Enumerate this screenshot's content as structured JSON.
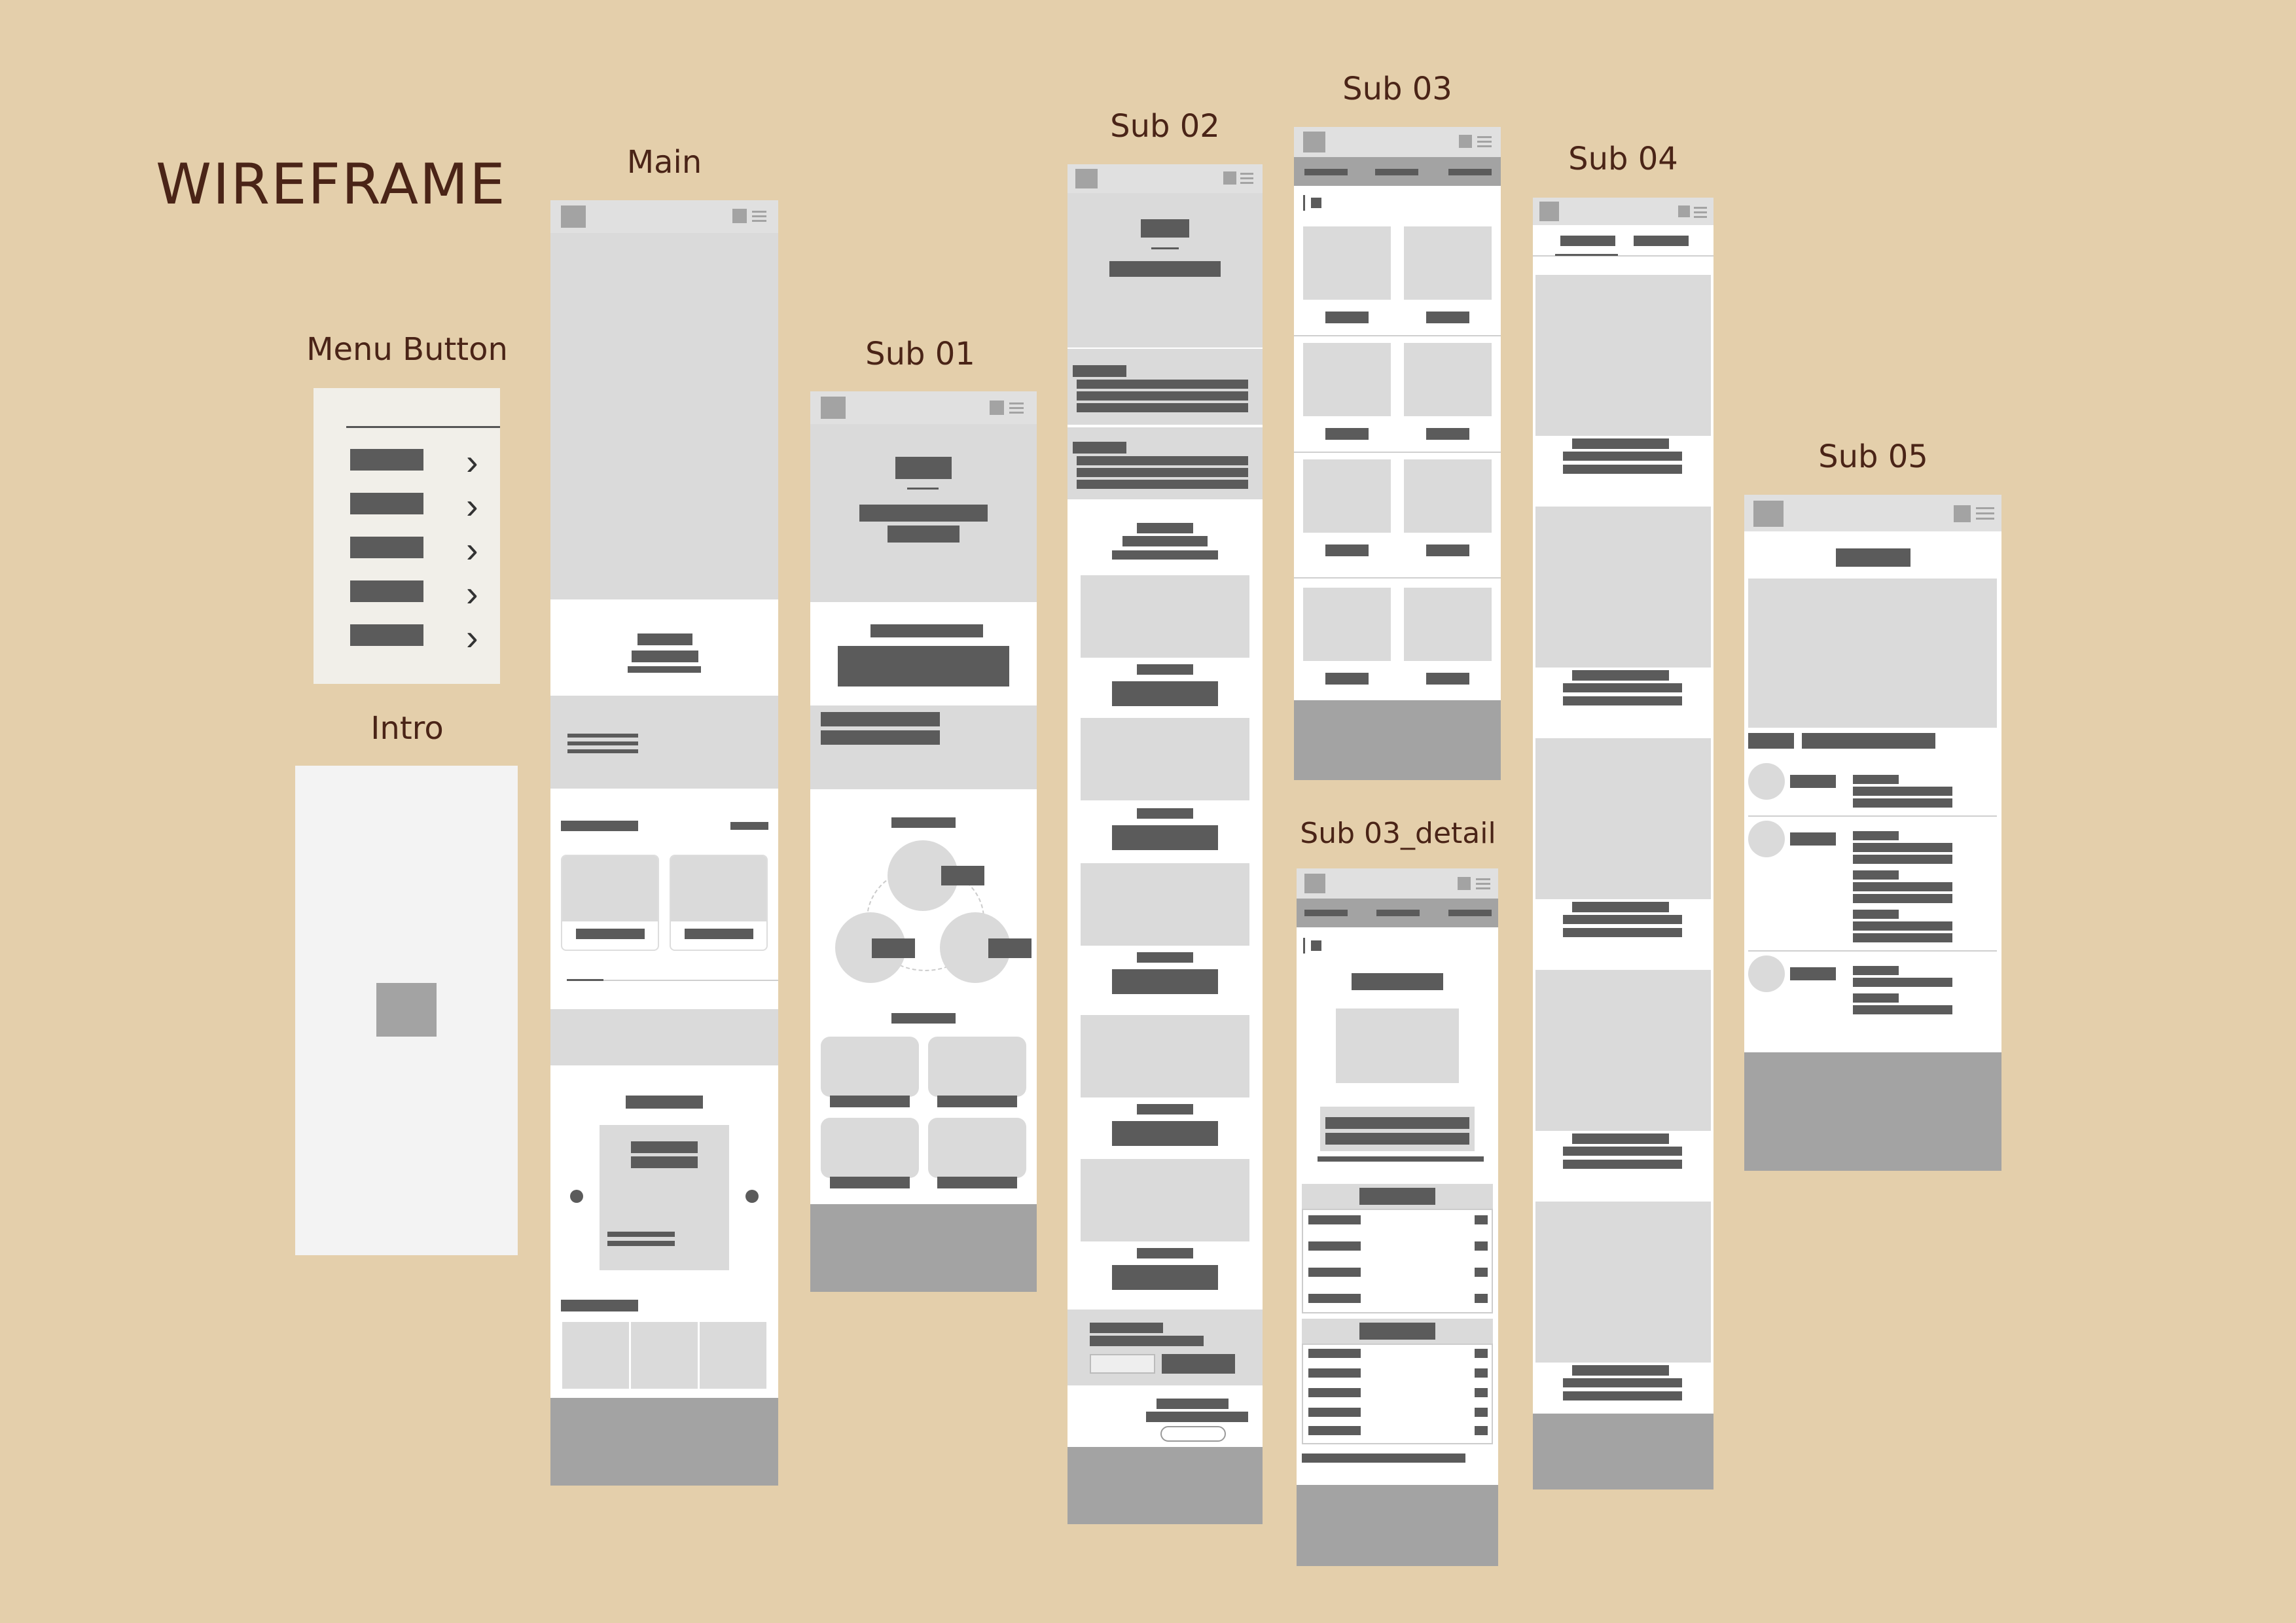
{
  "page": {
    "title": "WIREFRAME",
    "background": "#e4cfab",
    "text_color": "#4a2417"
  },
  "frames": {
    "menu_button": {
      "label": "Menu Button",
      "icons": [
        "chevron-right-icon",
        "chevron-right-icon",
        "chevron-right-icon",
        "chevron-right-icon",
        "chevron-right-icon"
      ]
    },
    "intro": {
      "label": "Intro"
    },
    "main": {
      "label": "Main",
      "icons": [
        "arrow-left-icon",
        "arrow-right-icon"
      ]
    },
    "sub01": {
      "label": "Sub 01"
    },
    "sub02": {
      "label": "Sub 02"
    },
    "sub03": {
      "label": "Sub 03"
    },
    "sub03_detail": {
      "label": "Sub 03_detail"
    },
    "sub04": {
      "label": "Sub 04"
    },
    "sub05": {
      "label": "Sub 05"
    }
  },
  "colors": {
    "light_gray": "#dadada",
    "mid_gray": "#a3a3a3",
    "dark_gray": "#5b5b5b",
    "header_gray": "#e0e0e0"
  }
}
